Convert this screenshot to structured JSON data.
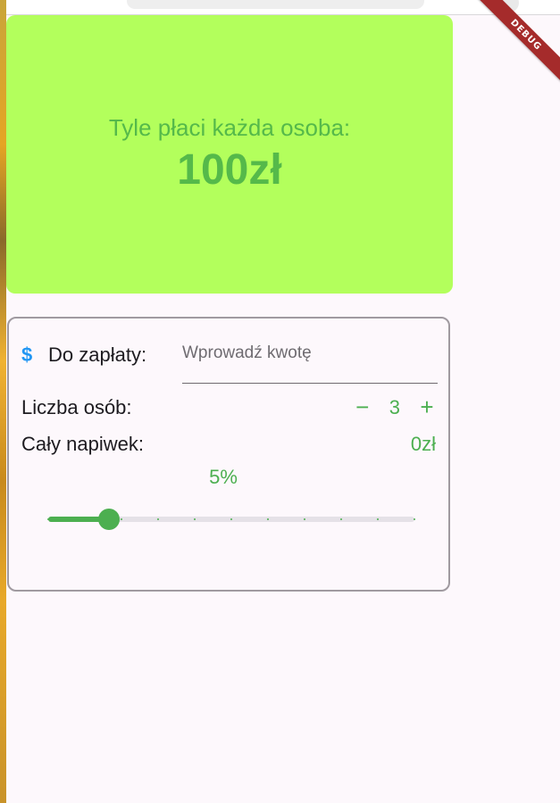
{
  "debug_banner": "DEBUG",
  "result": {
    "caption": "Tyle płaci każda osoba:",
    "amount": "100zł"
  },
  "bill": {
    "icon": "dollar-icon",
    "label": "Do zapłaty:",
    "placeholder": "Wprowadź kwotę",
    "value": ""
  },
  "people": {
    "label": "Liczba osób:",
    "decrement": "−",
    "count": "3",
    "increment": "+"
  },
  "tip": {
    "label": "Cały napiwek:",
    "amount": "0zł",
    "percent_label": "5%",
    "slider": {
      "value": 5,
      "min": 0,
      "max": 30,
      "divisions": 10
    }
  },
  "colors": {
    "accent": "#4caf50",
    "result_bg": "#b3ff5c",
    "result_text": "#55b94a",
    "icon_blue": "#2196f3",
    "debug_red": "#a52b2b"
  }
}
